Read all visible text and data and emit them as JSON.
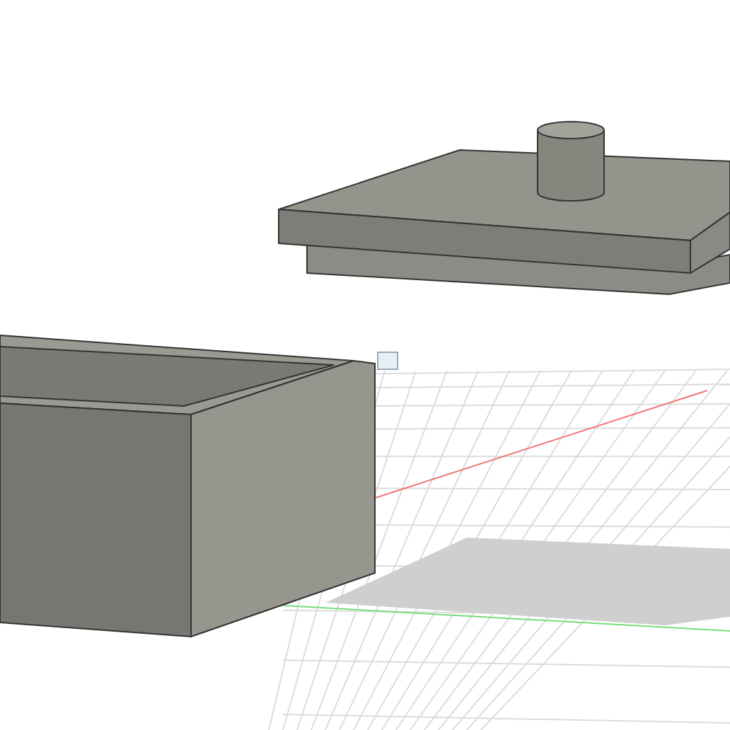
{
  "viewport": {
    "kind": "box-with-lid"
  }
}
